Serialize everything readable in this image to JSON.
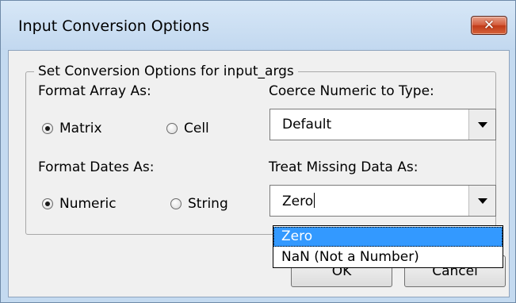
{
  "window": {
    "title": "Input Conversion Options",
    "close_glyph": "✕"
  },
  "group": {
    "legend": "Set Conversion Options for input_args",
    "format_array": {
      "label": "Format Array As:",
      "options": [
        {
          "label": "Matrix",
          "checked": true
        },
        {
          "label": "Cell",
          "checked": false
        }
      ]
    },
    "coerce_numeric": {
      "label": "Coerce Numeric to Type:",
      "value": "Default"
    },
    "format_dates": {
      "label": "Format Dates As:",
      "options": [
        {
          "label": "Numeric",
          "checked": true
        },
        {
          "label": "String",
          "checked": false
        }
      ]
    },
    "missing_data": {
      "label": "Treat Missing Data As:",
      "value": "Zero",
      "dropdown_options": [
        "Zero",
        "NaN (Not a Number)"
      ]
    }
  },
  "buttons": {
    "ok": "OK",
    "cancel": "Cancel"
  },
  "colors": {
    "frame": "#c4daf0",
    "dialog_bg": "#f0f0f0",
    "selection": "#3399ff",
    "close_button": "#c13a18"
  }
}
